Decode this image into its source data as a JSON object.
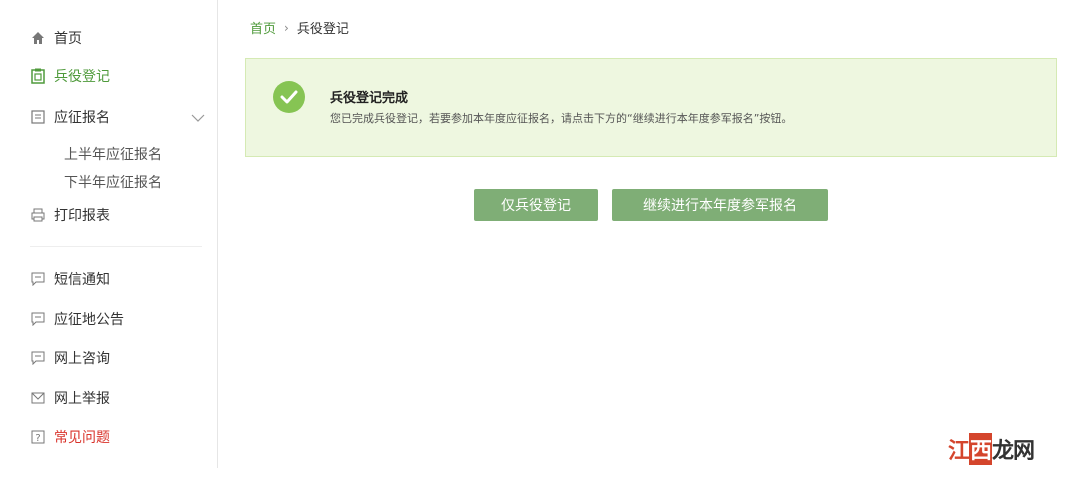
{
  "sidebar": {
    "items": [
      {
        "label": "首页",
        "icon": "home-icon"
      },
      {
        "label": "兵役登记",
        "icon": "clipboard-icon",
        "active": true
      },
      {
        "label": "应征报名",
        "icon": "document-icon",
        "expanded": true,
        "children": [
          {
            "label": "上半年应征报名"
          },
          {
            "label": "下半年应征报名"
          }
        ]
      },
      {
        "label": "打印报表",
        "icon": "printer-icon"
      },
      {
        "label": "短信通知",
        "icon": "chat-icon"
      },
      {
        "label": "应征地公告",
        "icon": "chat-icon"
      },
      {
        "label": "网上咨询",
        "icon": "chat-icon"
      },
      {
        "label": "网上举报",
        "icon": "mail-icon"
      },
      {
        "label": "常见问题",
        "icon": "question-icon"
      }
    ]
  },
  "breadcrumb": {
    "home": "首页",
    "separator": "›",
    "current": "兵役登记"
  },
  "alert": {
    "title": "兵役登记完成",
    "description": "您已完成兵役登记，若要参加本年度应征报名，请点击下方的“继续进行本年度参军报名”按钮。"
  },
  "actions": {
    "register_only_label": "仅兵役登记",
    "continue_label": "继续进行本年度参军报名"
  },
  "watermark": {
    "part1": "江",
    "part2": "西",
    "part3": "龙网"
  },
  "colors": {
    "accent": "#4f9a3b",
    "button": "#7fae76",
    "alert_bg": "#eef7e0",
    "danger": "#d9332b"
  }
}
